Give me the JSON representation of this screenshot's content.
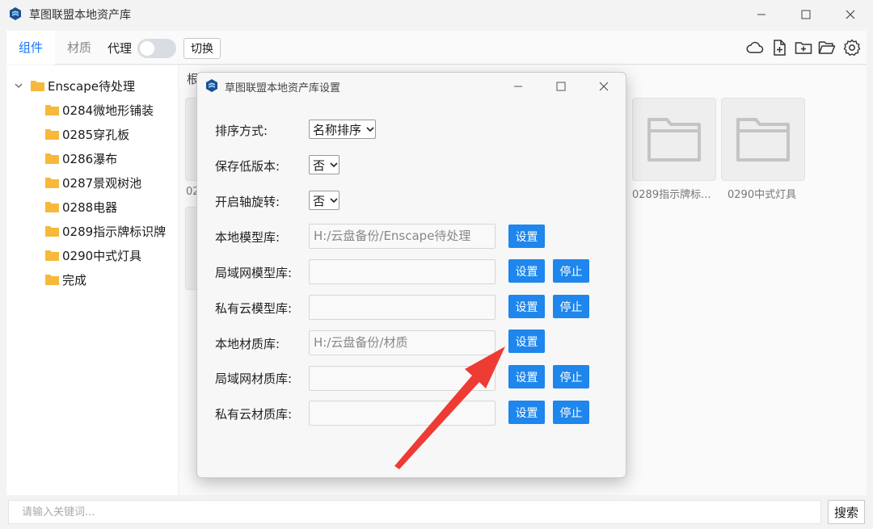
{
  "window": {
    "title": "草图联盟本地资产库"
  },
  "toolbar": {
    "tabs": [
      {
        "label": "组件",
        "active": true
      },
      {
        "label": "材质",
        "active": false
      }
    ],
    "proxy_label": "代理",
    "proxy_enabled": false,
    "switch_label": "切换",
    "icons": [
      "cloud-icon",
      "new-file-icon",
      "new-folder-icon",
      "open-folder-icon",
      "settings-icon"
    ]
  },
  "tree": {
    "root": "Enscape待处理",
    "items": [
      "0284微地形铺装",
      "0285穿孔板",
      "0286瀑布",
      "0287景观树池",
      "0288电器",
      "0289指示牌标识牌",
      "0290中式灯具",
      "完成"
    ]
  },
  "content": {
    "breadcrumb": "根",
    "cards": [
      {
        "label": "0289指示牌标..."
      },
      {
        "label": "0290中式灯具"
      }
    ],
    "partial_label": "02"
  },
  "search": {
    "placeholder": "请输入关键词...",
    "button": "搜索"
  },
  "dialog": {
    "title": "草图联盟本地资产库设置",
    "sort_label": "排序方式:",
    "sort_value": "名称排序",
    "save_low_label": "保存低版本:",
    "save_low_value": "否",
    "axis_label": "开启轴旋转:",
    "axis_value": "否",
    "rows": [
      {
        "label": "本地模型库:",
        "value": "H:/云盘备份/Enscape待处理",
        "set": "设置",
        "stop": null
      },
      {
        "label": "局域网模型库:",
        "value": "",
        "set": "设置",
        "stop": "停止"
      },
      {
        "label": "私有云模型库:",
        "value": "",
        "set": "设置",
        "stop": "停止"
      },
      {
        "label": "本地材质库:",
        "value": "H:/云盘备份/材质",
        "set": "设置",
        "stop": null
      },
      {
        "label": "局域网材质库:",
        "value": "",
        "set": "设置",
        "stop": "停止"
      },
      {
        "label": "私有云材质库:",
        "value": "",
        "set": "设置",
        "stop": "停止"
      }
    ]
  },
  "colors": {
    "accent": "#1677ff",
    "button_blue": "#1e86ec",
    "folder": "#f6b93b",
    "arrow": "#ee3b33"
  }
}
